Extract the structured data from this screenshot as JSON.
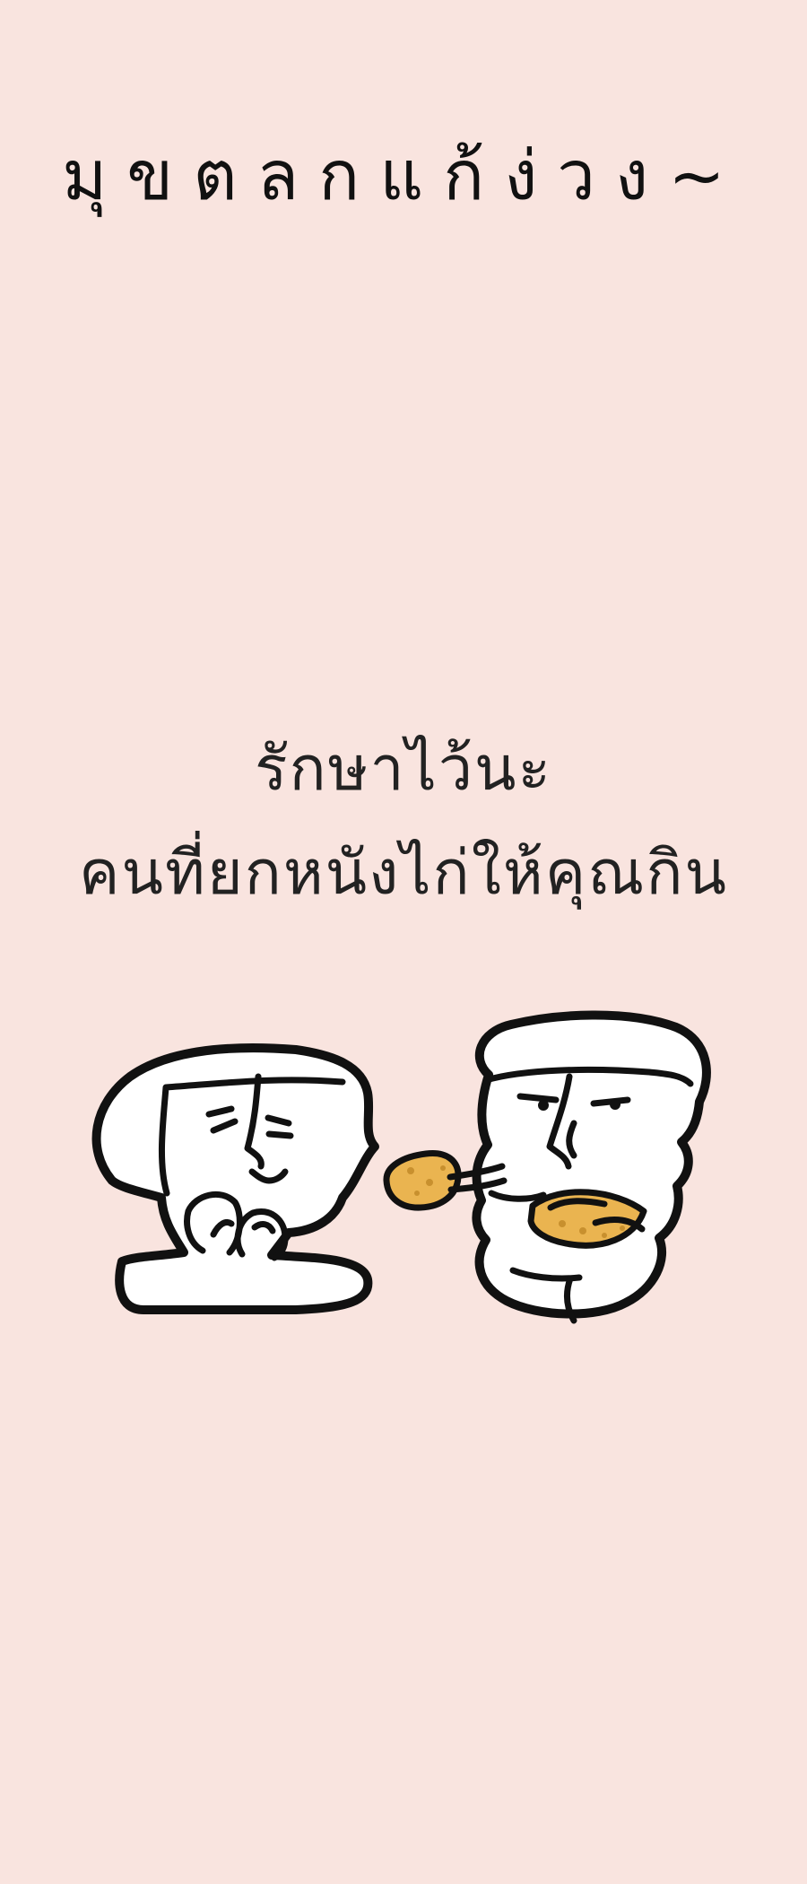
{
  "header": {
    "title": "มุขตลกแก้ง่วง~"
  },
  "quote": {
    "line1": "รักษาไว้นะ",
    "line2": "คนที่ยกหนังไก่ให้คุณกิน"
  },
  "colors": {
    "background": "#f9e4df",
    "text": "#111111",
    "chicken": "#eab450"
  },
  "illustration": {
    "figures": [
      "grateful-character",
      "sharing-character"
    ],
    "food": "fried-chicken-skin"
  }
}
